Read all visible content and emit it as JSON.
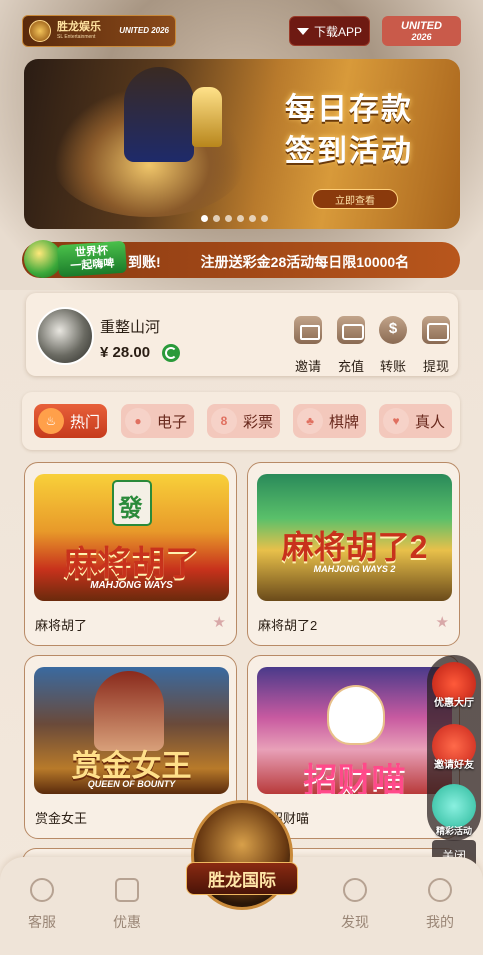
{
  "header": {
    "logo_title": "胜龙娱乐",
    "logo_subtitle": "SL Entertainment",
    "logo_united": "UNITED 2026",
    "download_label": "下载APP",
    "united_badge_line1": "UNITED",
    "united_badge_line2": "2026"
  },
  "banner": {
    "title_line1": "每日存款",
    "title_line2": "签到活动",
    "cta": "立即查看",
    "slide_count": 6,
    "active_slide": 1
  },
  "marquee": {
    "tag_line1": "世界杯",
    "tag_line2": "一起嗨啤",
    "text_prefix": "到账!",
    "text": "注册送彩金28活动每日限10000名"
  },
  "user": {
    "name": "重整山河",
    "balance": "¥ 28.00"
  },
  "actions": [
    {
      "label": "邀请",
      "icon": "invite-envelope-icon"
    },
    {
      "label": "充值",
      "icon": "deposit-card-icon"
    },
    {
      "label": "转账",
      "icon": "transfer-coin-icon"
    },
    {
      "label": "提现",
      "icon": "withdraw-wallet-icon"
    }
  ],
  "categories": [
    {
      "label": "热门",
      "icon": "fire-icon",
      "active": true
    },
    {
      "label": "电子",
      "icon": "slot-chip-icon",
      "active": false
    },
    {
      "label": "彩票",
      "icon": "lottery-ball-icon",
      "active": false
    },
    {
      "label": "棋牌",
      "icon": "card-club-icon",
      "active": false
    },
    {
      "label": "真人",
      "icon": "live-dealer-icon",
      "active": false
    }
  ],
  "games": [
    {
      "name": "麻将胡了",
      "art_title": "麻将胡了",
      "art_subtitle": "MAHJONG WAYS",
      "tile": "發"
    },
    {
      "name": "麻将胡了2",
      "art_title": "麻将胡了2",
      "art_subtitle": "MAHJONG WAYS 2"
    },
    {
      "name": "赏金女王",
      "art_title": "赏金女王",
      "art_subtitle": "QUEEN OF BOUNTY"
    },
    {
      "name": "招财喵",
      "art_title": "招财喵",
      "art_subtitle": ""
    }
  ],
  "float_menu": {
    "item1": "优惠大厅",
    "item2": "邀请好友",
    "item3": "精彩活动",
    "close": "关闭"
  },
  "bottom_nav": {
    "items": [
      "客服",
      "优惠",
      "发现",
      "我的"
    ],
    "center": "胜龙国际"
  },
  "colors": {
    "accent_red": "#c63a1c",
    "brown": "#8a3a12",
    "background": "#efe4d8"
  }
}
